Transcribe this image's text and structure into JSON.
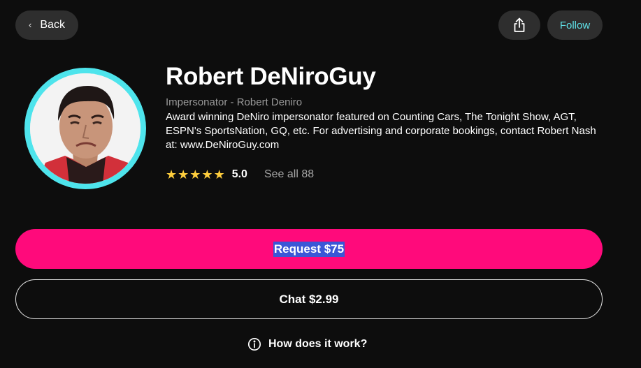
{
  "nav": {
    "back_label": "Back",
    "follow_label": "Follow"
  },
  "profile": {
    "name": "Robert DeNiroGuy",
    "subtitle": "Impersonator - Robert Deniro",
    "bio": "Award winning DeNiro impersonator featured on Counting Cars, The Tonight Show, AGT, ESPN's SportsNation, GQ, etc. For advertising and corporate bookings, contact Robert Nash at: www.DeNiroGuy.com",
    "rating": {
      "stars": 5,
      "value": "5.0",
      "see_all_label": "See all 88"
    }
  },
  "actions": {
    "request_label": "Request $75",
    "chat_label": "Chat $2.99",
    "how_label": "How does it work?"
  },
  "icons": {
    "back": "chevron-left-icon",
    "share": "share-icon",
    "star": "star-icon",
    "info": "info-icon"
  },
  "colors": {
    "background": "#0d0d0d",
    "avatar_ring": "#4ee4ec",
    "follow_text": "#5fe0e6",
    "request_button": "#ff0a7b",
    "star": "#ffce3d"
  }
}
